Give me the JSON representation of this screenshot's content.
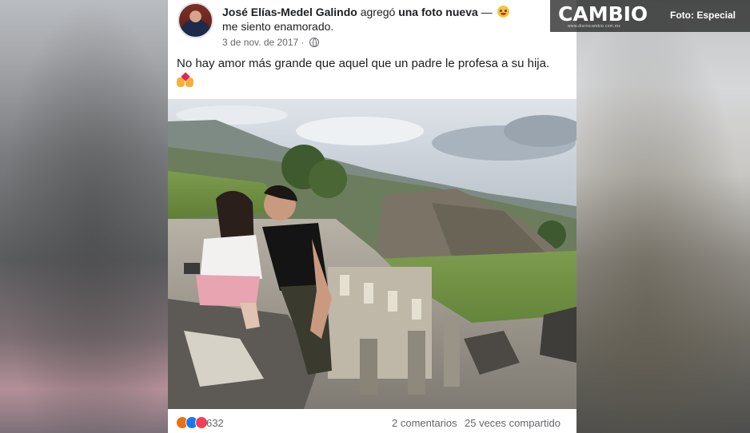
{
  "post": {
    "author": "José Elías-Medel Galindo",
    "action_prefix": "agregó",
    "action_object": "una foto nueva",
    "action_dash": "—",
    "feeling": "me siento enamorado.",
    "date": "3 de nov. de 2017",
    "date_separator": "·",
    "caption": "No hay amor más grande que aquel que un padre le profesa a su hija.",
    "reaction_count": "632",
    "comments": "2 comentarios",
    "shares": "25 veces compartido"
  },
  "watermark": {
    "logo": "CAMBIO",
    "subtitle": "www.diariocambio.com.mx",
    "credit": "Foto: Especial"
  },
  "icons": {
    "avatar": "avatar",
    "feeling": "smiling-face-with-hearts-icon",
    "privacy": "globe-icon",
    "caption_emoji": "fist-heart-emoji-icon",
    "reactions": [
      "angry-reaction-icon",
      "like-reaction-icon",
      "love-reaction-icon"
    ]
  },
  "colors": {
    "author_text": "#1c1e21",
    "meta_text": "#65676b",
    "like": "#1877f2",
    "love": "#f33e58",
    "angry": "#e9710f"
  }
}
